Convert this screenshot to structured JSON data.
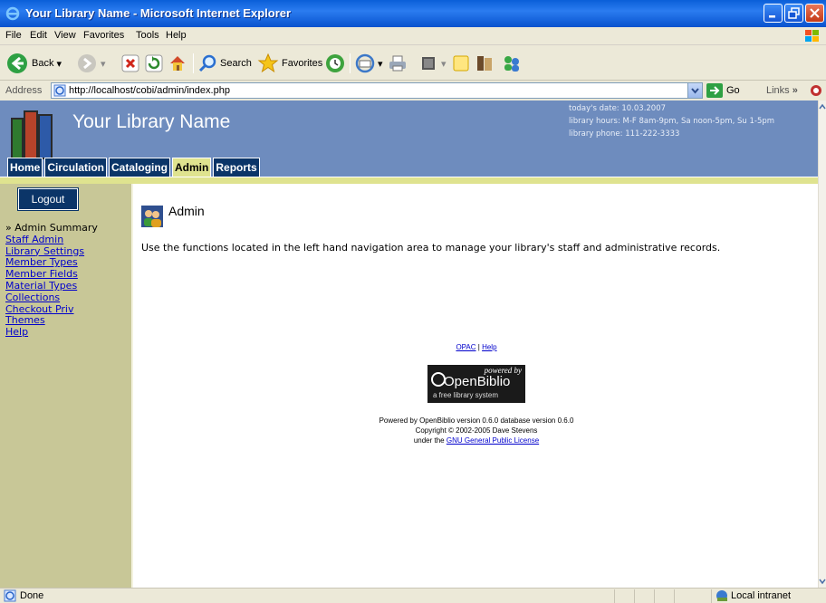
{
  "window": {
    "title": "Your Library Name - Microsoft Internet Explorer"
  },
  "menu": [
    "File",
    "Edit",
    "View",
    "Favorites",
    "Tools",
    "Help"
  ],
  "toolbar": {
    "back_label": "Back",
    "search_label": "Search",
    "favorites_label": "Favorites"
  },
  "address": {
    "label": "Address",
    "url": "http://localhost/cobi/admin/index.php",
    "go_label": "Go",
    "links_label": "Links"
  },
  "header": {
    "library_name": "Your Library Name",
    "date_line": "today's date: 10.03.2007",
    "hours_line": "library hours: M-F 8am-9pm, Sa noon-5pm, Su 1-5pm",
    "phone_line": "library phone: 111-222-3333"
  },
  "tabs": [
    {
      "label": "Home",
      "active": false
    },
    {
      "label": "Circulation",
      "active": false
    },
    {
      "label": "Cataloging",
      "active": false
    },
    {
      "label": "Admin",
      "active": true
    },
    {
      "label": "Reports",
      "active": false
    }
  ],
  "sidebar": {
    "logout_label": "Logout",
    "current_item": "» Admin Summary",
    "items": [
      "Staff Admin",
      "Library Settings",
      "Member Types",
      "Member Fields",
      "Material Types",
      "Collections",
      "Checkout Priv",
      "Themes",
      "Help"
    ]
  },
  "content": {
    "title": "Admin",
    "info": "Use the functions located in the left hand navigation area to manage your library's staff and administrative records."
  },
  "footer": {
    "opac_link": "OPAC",
    "separator": "|",
    "help_link": "Help",
    "logo_powered": "powered by",
    "logo_name": "OpenBiblio",
    "logo_tagline": "a free library system",
    "powered_line": "Powered by OpenBiblio version 0.6.0 database version 0.6.0",
    "copyright_line": "Copyright © 2002-2005 Dave Stevens",
    "license_prefix": "under the",
    "license_link": "GNU General Public License"
  },
  "status": {
    "text": "Done",
    "zone": "Local intranet"
  },
  "colors": {
    "header_bg": "#6e8cbe",
    "tab_bg": "#0b3568",
    "tab_active": "#dfe38f",
    "sidebar_bg": "#c8c797"
  }
}
